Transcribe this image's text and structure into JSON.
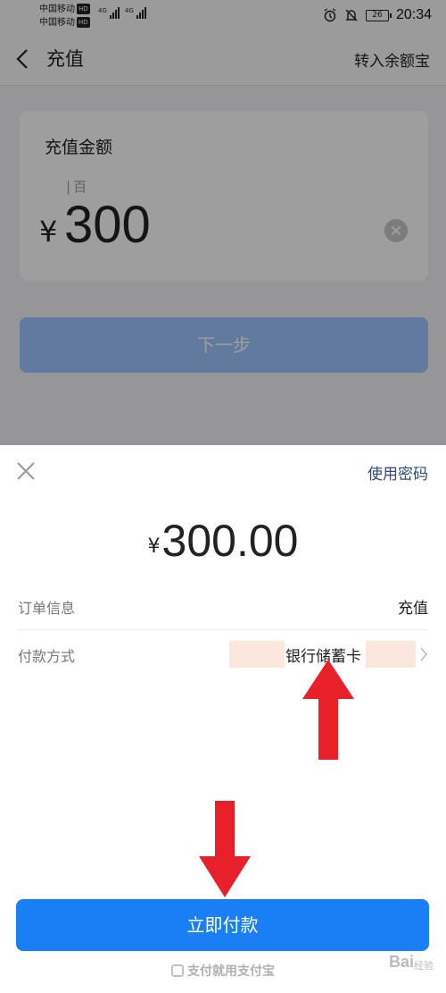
{
  "status_bar": {
    "carrier_1": "中国移动",
    "carrier_2": "中国移动",
    "hd_badge": "HD",
    "network_1": "4G",
    "network_2": "4G",
    "battery": "26",
    "time": "20:34"
  },
  "nav": {
    "title": "充值",
    "right_action": "转入余额宝"
  },
  "amount_card": {
    "label": "充值金额",
    "unit_hint": "百",
    "currency": "¥",
    "amount": "300"
  },
  "next_button": "下一步",
  "pay_sheet": {
    "use_password": "使用密码",
    "currency": "¥",
    "amount": "300.00",
    "order_label": "订单信息",
    "order_value": "充值",
    "method_label": "付款方式",
    "method_value": "银行储蓄卡",
    "pay_button": "立即付款",
    "brand": "支付就用支付宝"
  },
  "watermark": {
    "text": "Bai",
    "sub": "经验"
  },
  "colors": {
    "pay_button": "#1a7ff5",
    "next_button": "#9ec5ff",
    "arrows": "#e8202a",
    "link": "#2d4a7a"
  }
}
